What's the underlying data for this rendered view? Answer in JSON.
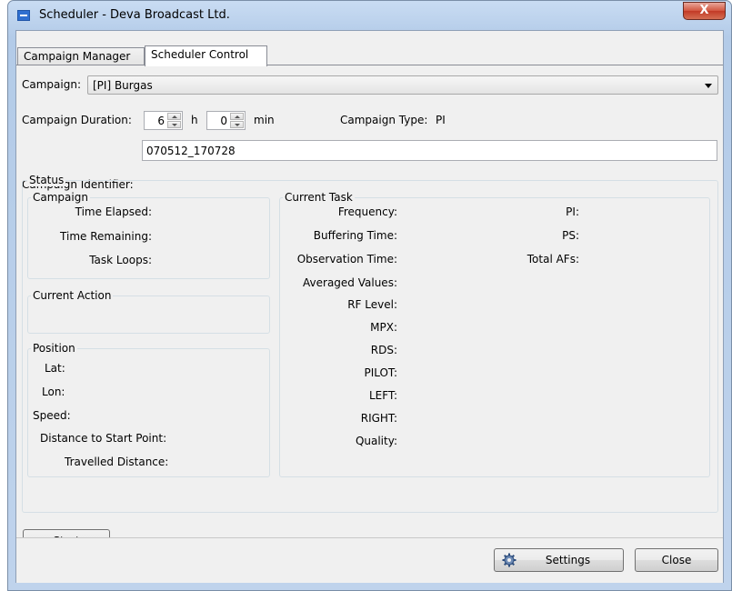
{
  "window": {
    "title": "Scheduler - Deva Broadcast Ltd.",
    "close_glyph": "X"
  },
  "tabs": [
    {
      "label": "Campaign Manager",
      "active": false
    },
    {
      "label": "Scheduler Control",
      "active": true
    }
  ],
  "campaign": {
    "label": "Campaign:",
    "selected": "[PI] Burgas"
  },
  "duration": {
    "label": "Campaign Duration:",
    "hours": "6",
    "hours_unit": "h",
    "minutes": "0",
    "minutes_unit": "min"
  },
  "campaign_type": {
    "label": "Campaign Type:",
    "value": "PI"
  },
  "identifier": {
    "label": "Campaign Identifier:",
    "value": "070512_170728"
  },
  "status": {
    "title": "Status",
    "campaign_group": {
      "title": "Campaign",
      "time_elapsed": "Time Elapsed:",
      "time_remaining": "Time Remaining:",
      "task_loops": "Task Loops:"
    },
    "current_action": {
      "title": "Current Action"
    },
    "position": {
      "title": "Position",
      "lat": "Lat:",
      "lon": "Lon:",
      "speed": "Speed:",
      "distance_start": "Distance to Start Point:",
      "travelled": "Travelled Distance:"
    },
    "current_task": {
      "title": "Current Task",
      "frequency": "Frequency:",
      "buffering_time": "Buffering Time:",
      "observation_time": "Observation Time:",
      "averaged_values": "Averaged Values:",
      "rf_level": "RF Level:",
      "mpx": "MPX:",
      "rds": "RDS:",
      "pilot": "PILOT:",
      "left": "LEFT:",
      "right": "RIGHT:",
      "quality": "Quality:",
      "pi": "PI:",
      "ps": "PS:",
      "total_afs": "Total AFs:"
    }
  },
  "buttons": {
    "start": "Start",
    "settings": "Settings",
    "close": "Close"
  },
  "icons": {
    "app": "window-icon",
    "settings": "gear-icon"
  }
}
